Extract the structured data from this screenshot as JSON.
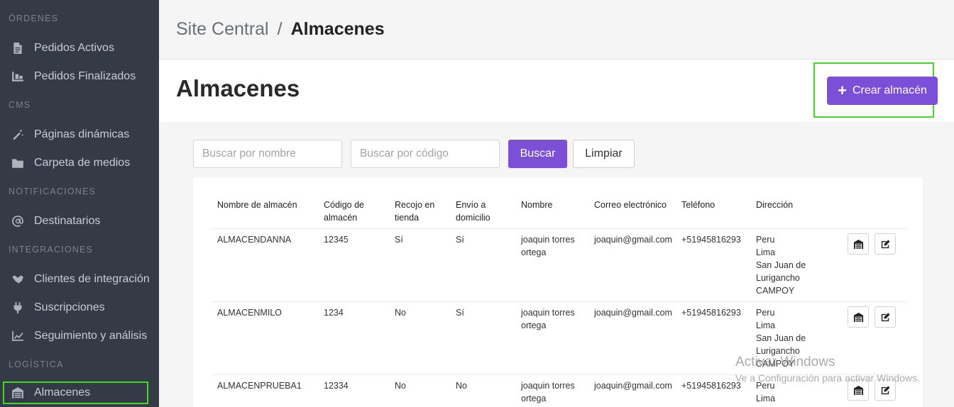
{
  "sidebar": {
    "sections": [
      {
        "label": "ÓRDENES",
        "items": [
          {
            "label": "Pedidos Activos",
            "icon": "document-icon"
          },
          {
            "label": "Pedidos Finalizados",
            "icon": "dolly-icon"
          }
        ]
      },
      {
        "label": "CMS",
        "items": [
          {
            "label": "Páginas dinámicas",
            "icon": "magic-wand-icon"
          },
          {
            "label": "Carpeta de medios",
            "icon": "folder-icon"
          }
        ]
      },
      {
        "label": "NOTIFICACIONES",
        "items": [
          {
            "label": "Destinatarios",
            "icon": "at-icon"
          }
        ]
      },
      {
        "label": "INTEGRACIONES",
        "items": [
          {
            "label": "Clientes de integración",
            "icon": "handshake-icon"
          },
          {
            "label": "Suscripciones",
            "icon": "plug-icon"
          },
          {
            "label": "Seguimiento y análisis",
            "icon": "chart-line-icon"
          }
        ]
      },
      {
        "label": "LOGÍSTICA",
        "items": [
          {
            "label": "Almacenes",
            "icon": "warehouse-icon",
            "active": true
          }
        ]
      }
    ]
  },
  "breadcrumb": {
    "root": "Site Central",
    "separator": "/",
    "current": "Almacenes"
  },
  "page": {
    "title": "Almacenes",
    "create_button": "Crear almacén"
  },
  "search": {
    "name_placeholder": "Buscar por nombre",
    "code_placeholder": "Buscar por código",
    "search_button": "Buscar",
    "clear_button": "Limpiar"
  },
  "table": {
    "headers": [
      [
        "Nombre de almacén"
      ],
      [
        "Código de",
        "almacén"
      ],
      [
        "Recojo en",
        "tienda"
      ],
      [
        "Envío a",
        "domicilio"
      ],
      [
        "Nombre"
      ],
      [
        "Correo electrónico"
      ],
      [
        "Teléfono"
      ],
      [
        "Dirección"
      ]
    ],
    "rows": [
      {
        "name": "ALMACENDANNA",
        "code": "12345",
        "pickup": "Sí",
        "delivery": "Sí",
        "contact": [
          "joaquin torres",
          "ortega"
        ],
        "email": "joaquin@gmail.com",
        "phone": "+51945816293",
        "address": [
          "Peru",
          "Lima",
          "San Juan de",
          "Lurigancho",
          "CAMPOY"
        ]
      },
      {
        "name": "ALMACENMILO",
        "code": "1234",
        "pickup": "No",
        "delivery": "Sí",
        "contact": [
          "joaquin torres",
          "ortega"
        ],
        "email": "joaquin@gmail.com",
        "phone": "+51945816293",
        "address": [
          "Peru",
          "Lima",
          "San Juan de",
          "Lurigancho",
          "CAMPOY"
        ]
      },
      {
        "name": "ALMACENPRUEBA1",
        "code": "12334",
        "pickup": "No",
        "delivery": "No",
        "contact": [
          "joaquin torres",
          "ortega"
        ],
        "email": "joaquin@gmail.com",
        "phone": "+51945816293",
        "address": [
          "Peru",
          "Lima"
        ]
      }
    ]
  },
  "watermark": {
    "line1": "Activar Windows",
    "line2": "Ve a Configuración para activar Windows."
  },
  "colors": {
    "sidebar_bg": "#343a46",
    "accent": "#7b4fd6",
    "highlight": "#3fd926"
  }
}
